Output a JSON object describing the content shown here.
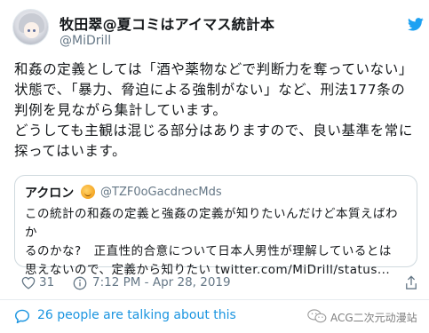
{
  "author": {
    "display_name": "牧田翠@夏コミはアイマス統計本",
    "handle": "@MiDrill"
  },
  "tweet": {
    "text": "和姦の定義としては「酒や薬物などで判断力を奪っていない」\n状態で、「暴力、脅迫による強制がない」など、刑法177条の\n判例を見ながら集計しています。\nどうしても主観は混じる部分はありますので、良い基準を常に\n探ってはいます。"
  },
  "quote": {
    "name": "アクロン",
    "handle": "@TZF0oGacdnecMds",
    "text": "この統計の和姦の定義と強姦の定義が知りたいんだけど本質えばわか\nるのかな?　正直性的合意について日本人男性が理解しているとは\n思えないので、定義から知りたい ",
    "link": "twitter.com/MiDrill/status..."
  },
  "actions": {
    "like_count": "31",
    "timestamp": "7:12 PM - Apr 28, 2019"
  },
  "footer": {
    "talking": "26 people are talking about this"
  },
  "watermark": {
    "text": "ACG二次元动漫站"
  },
  "colors": {
    "accent": "#1b95e0",
    "secondary_text": "#657786",
    "twitter_bird": "#1da1f2",
    "border": "#cfd9de"
  },
  "icons": [
    "twitter-bird-icon",
    "heart-icon",
    "info-icon",
    "share-icon",
    "comment-icon",
    "wechat-icon"
  ]
}
